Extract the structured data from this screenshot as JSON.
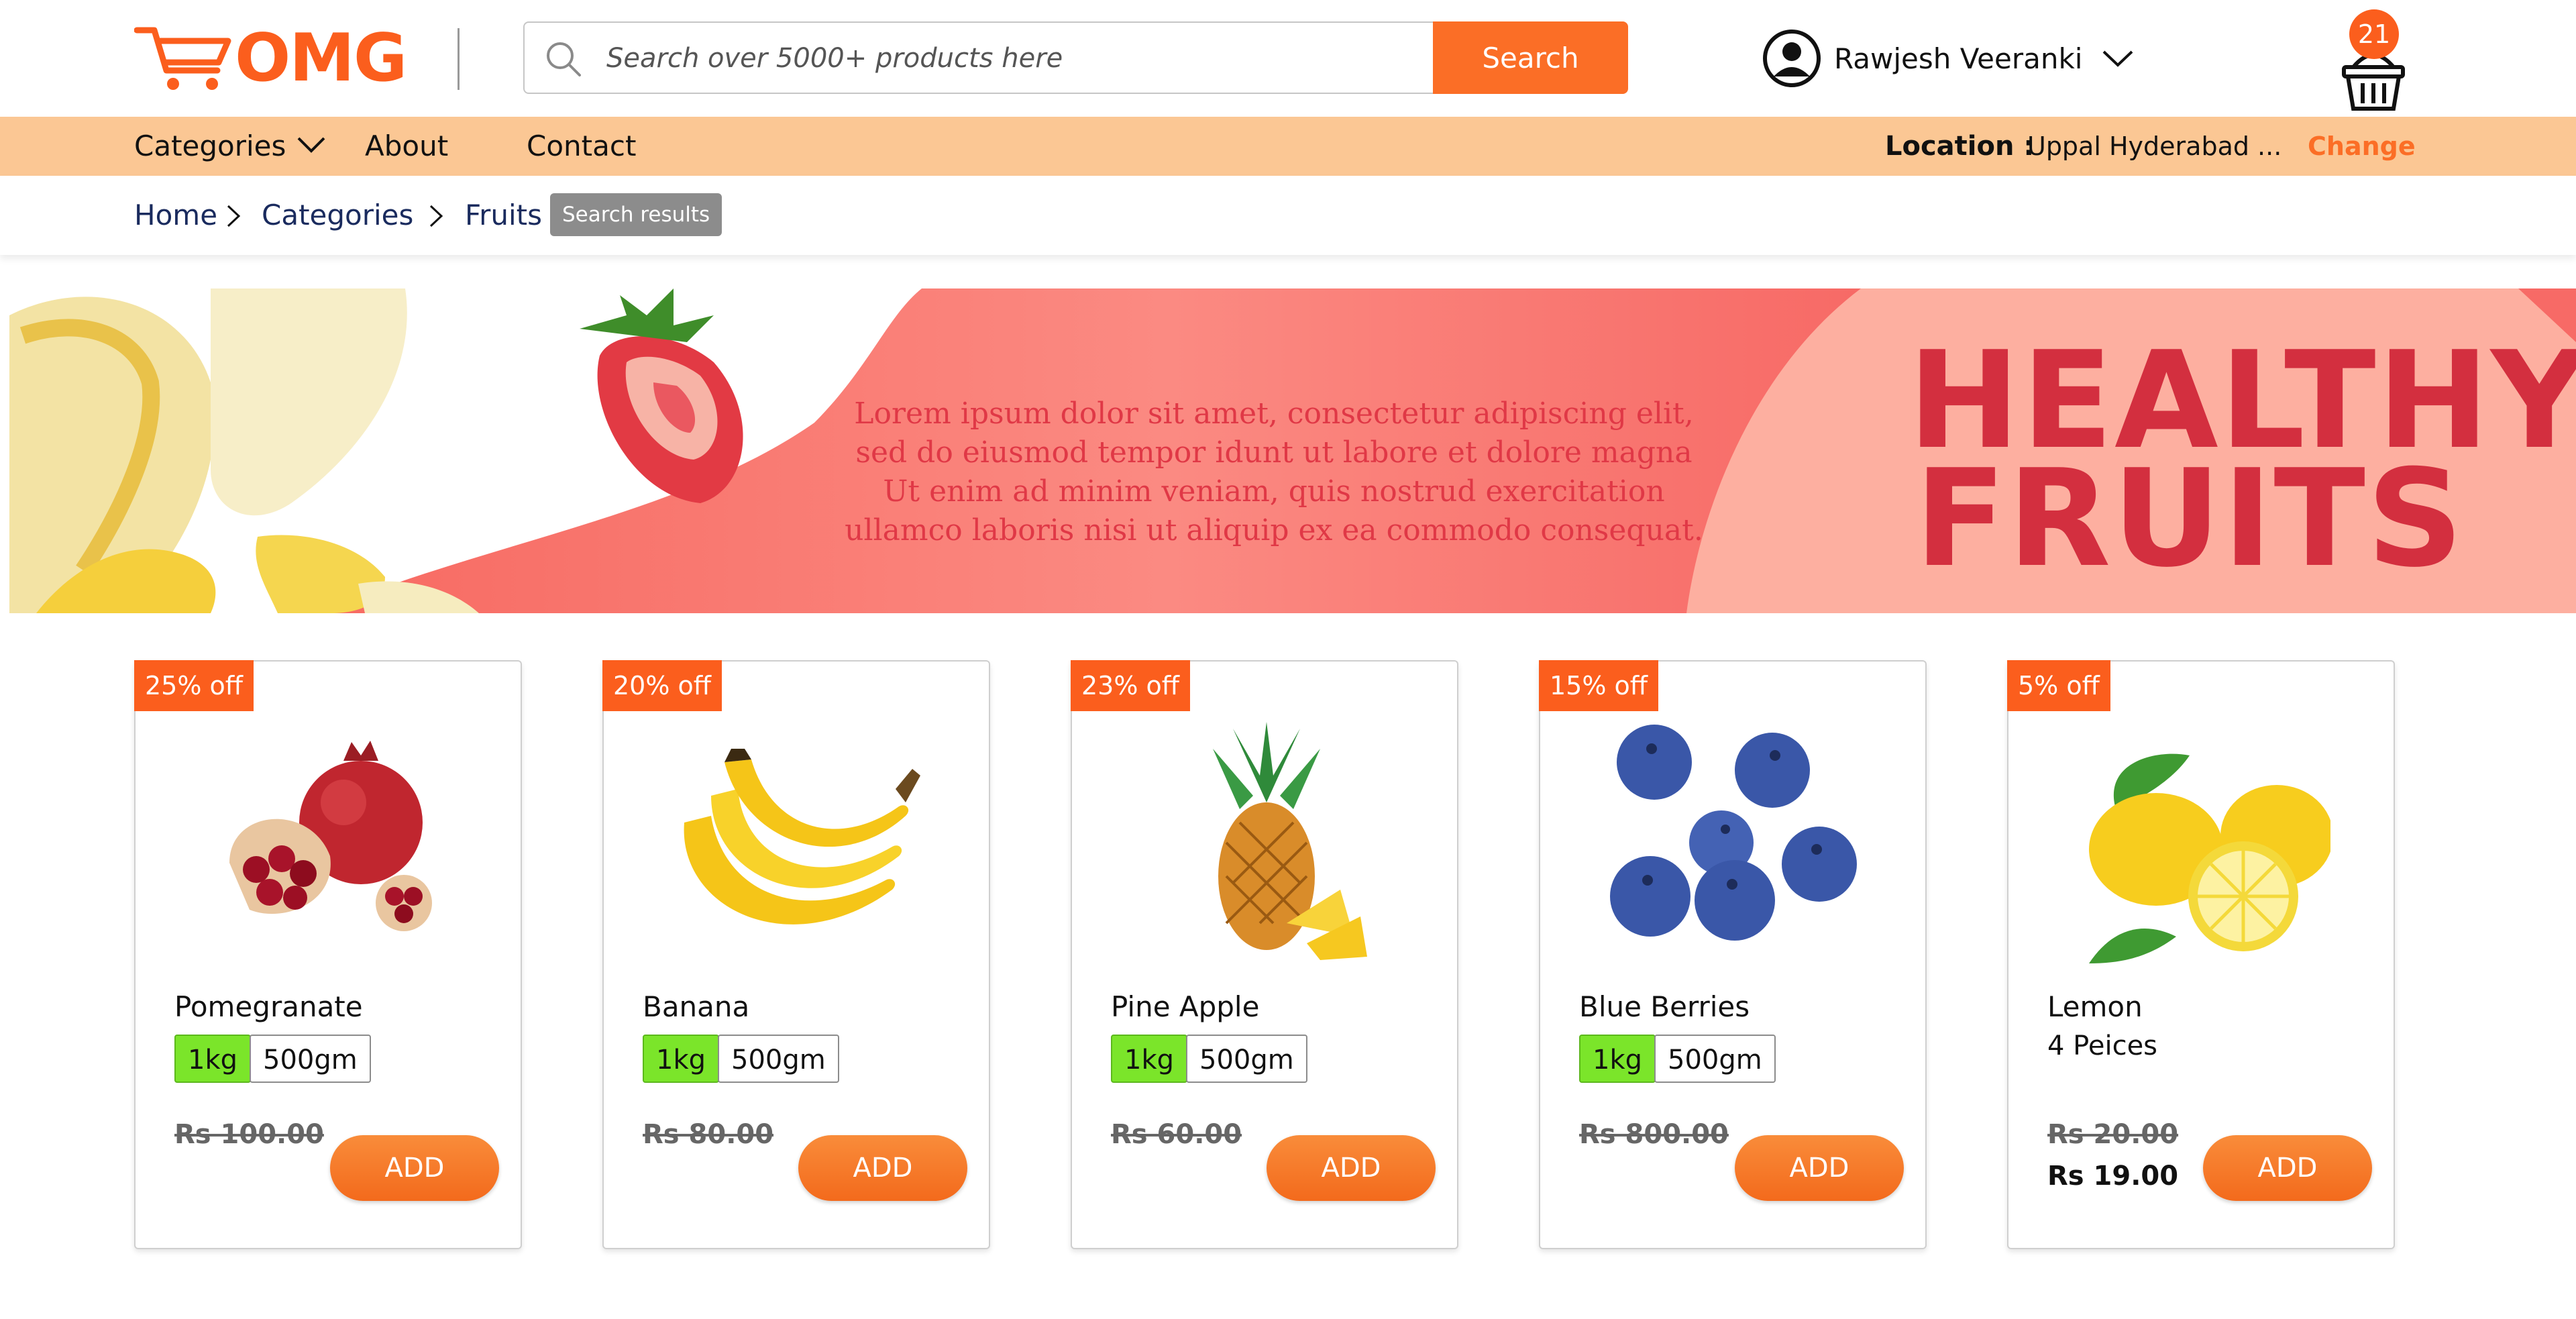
{
  "brand": {
    "logo_text": "OMG",
    "accent": "#fb5e1d"
  },
  "search": {
    "placeholder": "Search over 5000+ products here",
    "button_label": "Search"
  },
  "user": {
    "name": "Rawjesh Veeranki"
  },
  "cart": {
    "count": "21"
  },
  "nav": {
    "items": [
      "Categories",
      "About",
      "Contact"
    ]
  },
  "location": {
    "label": "Location :",
    "value": "Uppal Hyderabad ...",
    "change_label": "Change"
  },
  "breadcrumb": {
    "items": [
      "Home",
      "Categories",
      "Fruits"
    ],
    "badge": "Search results"
  },
  "banner": {
    "lines": [
      "Lorem ipsum dolor sit amet, consectetur adipiscing elit,",
      "sed do eiusmod tempor idunt ut labore et dolore magna",
      "Ut enim ad minim veniam,  quis nostrud exercitation",
      "ullamco laboris nisi ut aliquip ex ea commodo consequat."
    ],
    "heading_1": "HEALTHY",
    "heading_2": "FRUITS"
  },
  "products": [
    {
      "discount": "25% off",
      "name": "Pomegranate",
      "sizes": [
        "1kg",
        "500gm"
      ],
      "old_price": "Rs 100.00",
      "add_label": "ADD"
    },
    {
      "discount": "20% off",
      "name": "Banana",
      "sizes": [
        "1kg",
        "500gm"
      ],
      "old_price": "Rs 80.00",
      "add_label": "ADD"
    },
    {
      "discount": "23% off",
      "name": "Pine Apple",
      "sizes": [
        "1kg",
        "500gm"
      ],
      "old_price": "Rs 60.00",
      "add_label": "ADD"
    },
    {
      "discount": "15% off",
      "name": "Blue Berries",
      "sizes": [
        "1kg",
        "500gm"
      ],
      "old_price": "Rs 800.00",
      "add_label": "ADD"
    },
    {
      "discount": "5% off",
      "name": "Lemon",
      "subtitle": "4 Peices",
      "old_price": "Rs 20.00",
      "new_price": "Rs 19.00",
      "add_label": "ADD"
    }
  ]
}
